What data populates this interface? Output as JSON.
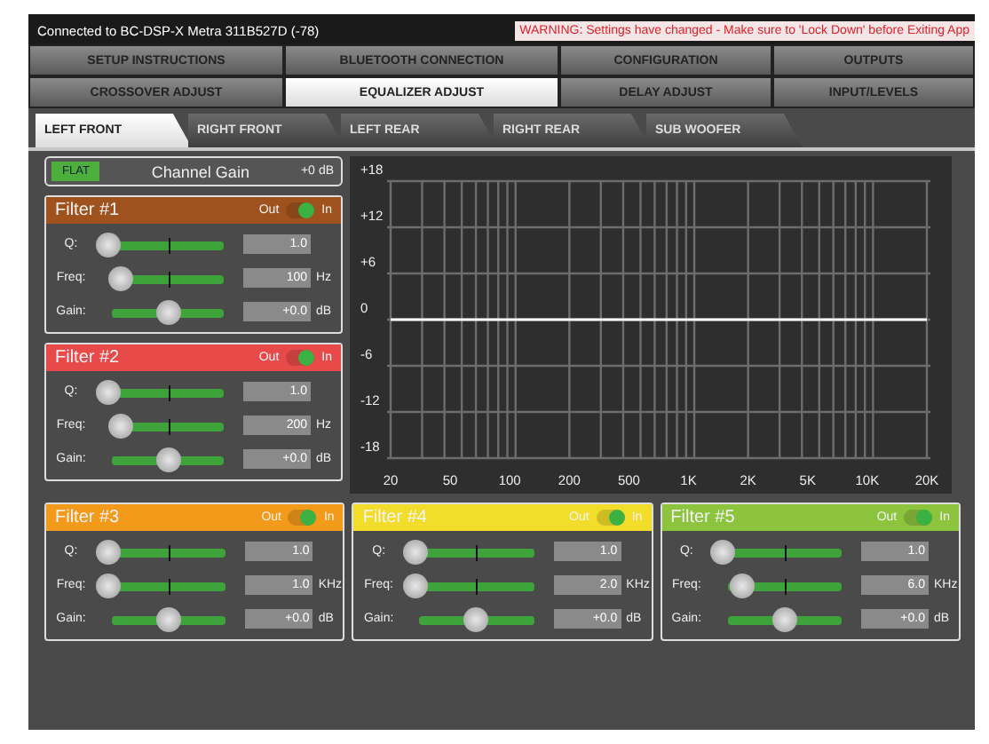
{
  "status_bar": {
    "connection": "Connected to BC-DSP-X Metra 311B527D (-78)",
    "warning": "WARNING: Settings have changed - Make sure to 'Lock Down' before Exiting App"
  },
  "main_tabs": [
    {
      "label": "SETUP INSTRUCTIONS",
      "selected": false
    },
    {
      "label": "BLUETOOTH CONNECTION",
      "selected": false
    },
    {
      "label": "CONFIGURATION",
      "selected": false
    },
    {
      "label": "OUTPUTS",
      "selected": false
    },
    {
      "label": "CROSSOVER ADJUST",
      "selected": false
    },
    {
      "label": "EQUALIZER ADJUST",
      "selected": true
    },
    {
      "label": "DELAY ADJUST",
      "selected": false
    },
    {
      "label": "INPUT/LEVELS",
      "selected": false
    }
  ],
  "channel_tabs": [
    {
      "label": "LEFT FRONT",
      "selected": true
    },
    {
      "label": "RIGHT FRONT",
      "selected": false
    },
    {
      "label": "LEFT REAR",
      "selected": false
    },
    {
      "label": "RIGHT REAR",
      "selected": false
    },
    {
      "label": "SUB WOOFER",
      "selected": false
    }
  ],
  "channel_gain": {
    "button": "FLAT",
    "label": "Channel Gain",
    "reading": "+0",
    "unit": "dB"
  },
  "filters": [
    {
      "title": "Filter #1",
      "color": "#a0521e",
      "off_label": "Out",
      "on_label": "In",
      "on": true,
      "params": [
        {
          "label": "Q:",
          "level": 0.06,
          "reading": "1.0"
        },
        {
          "label": "Freq:",
          "level": 0.15,
          "reading": "100",
          "unit": "Hz"
        },
        {
          "label": "Gain:",
          "level": 0.5,
          "reading": "+0.0",
          "unit": "dB"
        }
      ]
    },
    {
      "title": "Filter #2",
      "color": "#e84a4a",
      "off_label": "Out",
      "on_label": "In",
      "on": true,
      "params": [
        {
          "label": "Q:",
          "level": 0.06,
          "reading": "1.0"
        },
        {
          "label": "Freq:",
          "level": 0.15,
          "reading": "200",
          "unit": "Hz"
        },
        {
          "label": "Gain:",
          "level": 0.5,
          "reading": "+0.0",
          "unit": "dB"
        }
      ]
    },
    {
      "title": "Filter #3",
      "color": "#f39a1a",
      "off_label": "Out",
      "on_label": "In",
      "on": true,
      "params": [
        {
          "label": "Q:",
          "level": 0.06,
          "reading": "1.0"
        },
        {
          "label": "Freq:",
          "level": 0.06,
          "reading": "1.0",
          "unit": "KHz"
        },
        {
          "label": "Gain:",
          "level": 0.5,
          "reading": "+0.0",
          "unit": "dB"
        }
      ]
    },
    {
      "title": "Filter #4",
      "color": "#f2dd2a",
      "off_label": "Out",
      "on_label": "In",
      "on": true,
      "params": [
        {
          "label": "Q:",
          "level": 0.06,
          "reading": "1.0"
        },
        {
          "label": "Freq:",
          "level": 0.06,
          "reading": "2.0",
          "unit": "KHz"
        },
        {
          "label": "Gain:",
          "level": 0.5,
          "reading": "+0.0",
          "unit": "dB"
        }
      ]
    },
    {
      "title": "Filter #5",
      "color": "#8cc43e",
      "off_label": "Out",
      "on_label": "In",
      "on": true,
      "params": [
        {
          "label": "Q:",
          "level": 0.06,
          "reading": "1.0"
        },
        {
          "label": "Freq:",
          "level": 0.2,
          "reading": "6.0",
          "unit": "KHz"
        },
        {
          "label": "Gain:",
          "level": 0.5,
          "reading": "+0.0",
          "unit": "dB"
        }
      ]
    }
  ],
  "response_graph": {
    "chart_data": {
      "type": "line",
      "categories": [
        "20",
        "50",
        "100",
        "200",
        "500",
        "1K",
        "2K",
        "5K",
        "10K",
        "20K"
      ],
      "ylim": [
        -18,
        18
      ],
      "grid": true,
      "series": [
        {
          "color": "#ffffff",
          "values": [
            0,
            0,
            0,
            0,
            0,
            0,
            0,
            0,
            0,
            0
          ]
        }
      ],
      "yticks": [
        {
          "value": 18,
          "label": "+18"
        },
        {
          "value": 12,
          "label": "+12"
        },
        {
          "value": 6,
          "label": "+6"
        },
        0,
        -6,
        -12,
        -18
      ]
    }
  }
}
